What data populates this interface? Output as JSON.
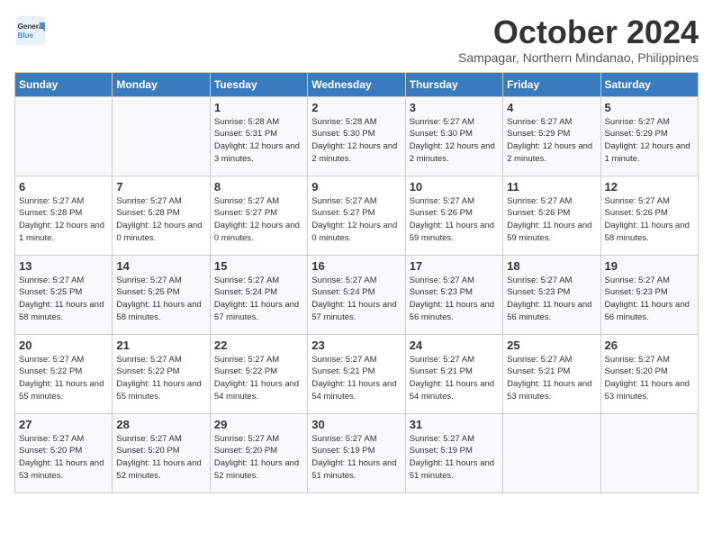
{
  "logo": {
    "line1": "General",
    "line2": "Blue"
  },
  "title": "October 2024",
  "subtitle": "Sampagar, Northern Mindanao, Philippines",
  "days_of_week": [
    "Sunday",
    "Monday",
    "Tuesday",
    "Wednesday",
    "Thursday",
    "Friday",
    "Saturday"
  ],
  "weeks": [
    [
      {
        "day": "",
        "info": ""
      },
      {
        "day": "",
        "info": ""
      },
      {
        "day": "1",
        "info": "Sunrise: 5:28 AM\nSunset: 5:31 PM\nDaylight: 12 hours and 3 minutes."
      },
      {
        "day": "2",
        "info": "Sunrise: 5:28 AM\nSunset: 5:30 PM\nDaylight: 12 hours and 2 minutes."
      },
      {
        "day": "3",
        "info": "Sunrise: 5:27 AM\nSunset: 5:30 PM\nDaylight: 12 hours and 2 minutes."
      },
      {
        "day": "4",
        "info": "Sunrise: 5:27 AM\nSunset: 5:29 PM\nDaylight: 12 hours and 2 minutes."
      },
      {
        "day": "5",
        "info": "Sunrise: 5:27 AM\nSunset: 5:29 PM\nDaylight: 12 hours and 1 minute."
      }
    ],
    [
      {
        "day": "6",
        "info": "Sunrise: 5:27 AM\nSunset: 5:28 PM\nDaylight: 12 hours and 1 minute."
      },
      {
        "day": "7",
        "info": "Sunrise: 5:27 AM\nSunset: 5:28 PM\nDaylight: 12 hours and 0 minutes."
      },
      {
        "day": "8",
        "info": "Sunrise: 5:27 AM\nSunset: 5:27 PM\nDaylight: 12 hours and 0 minutes."
      },
      {
        "day": "9",
        "info": "Sunrise: 5:27 AM\nSunset: 5:27 PM\nDaylight: 12 hours and 0 minutes."
      },
      {
        "day": "10",
        "info": "Sunrise: 5:27 AM\nSunset: 5:26 PM\nDaylight: 11 hours and 59 minutes."
      },
      {
        "day": "11",
        "info": "Sunrise: 5:27 AM\nSunset: 5:26 PM\nDaylight: 11 hours and 59 minutes."
      },
      {
        "day": "12",
        "info": "Sunrise: 5:27 AM\nSunset: 5:26 PM\nDaylight: 11 hours and 58 minutes."
      }
    ],
    [
      {
        "day": "13",
        "info": "Sunrise: 5:27 AM\nSunset: 5:25 PM\nDaylight: 11 hours and 58 minutes."
      },
      {
        "day": "14",
        "info": "Sunrise: 5:27 AM\nSunset: 5:25 PM\nDaylight: 11 hours and 58 minutes."
      },
      {
        "day": "15",
        "info": "Sunrise: 5:27 AM\nSunset: 5:24 PM\nDaylight: 11 hours and 57 minutes."
      },
      {
        "day": "16",
        "info": "Sunrise: 5:27 AM\nSunset: 5:24 PM\nDaylight: 11 hours and 57 minutes."
      },
      {
        "day": "17",
        "info": "Sunrise: 5:27 AM\nSunset: 5:23 PM\nDaylight: 11 hours and 56 minutes."
      },
      {
        "day": "18",
        "info": "Sunrise: 5:27 AM\nSunset: 5:23 PM\nDaylight: 11 hours and 56 minutes."
      },
      {
        "day": "19",
        "info": "Sunrise: 5:27 AM\nSunset: 5:23 PM\nDaylight: 11 hours and 56 minutes."
      }
    ],
    [
      {
        "day": "20",
        "info": "Sunrise: 5:27 AM\nSunset: 5:22 PM\nDaylight: 11 hours and 55 minutes."
      },
      {
        "day": "21",
        "info": "Sunrise: 5:27 AM\nSunset: 5:22 PM\nDaylight: 11 hours and 55 minutes."
      },
      {
        "day": "22",
        "info": "Sunrise: 5:27 AM\nSunset: 5:22 PM\nDaylight: 11 hours and 54 minutes."
      },
      {
        "day": "23",
        "info": "Sunrise: 5:27 AM\nSunset: 5:21 PM\nDaylight: 11 hours and 54 minutes."
      },
      {
        "day": "24",
        "info": "Sunrise: 5:27 AM\nSunset: 5:21 PM\nDaylight: 11 hours and 54 minutes."
      },
      {
        "day": "25",
        "info": "Sunrise: 5:27 AM\nSunset: 5:21 PM\nDaylight: 11 hours and 53 minutes."
      },
      {
        "day": "26",
        "info": "Sunrise: 5:27 AM\nSunset: 5:20 PM\nDaylight: 11 hours and 53 minutes."
      }
    ],
    [
      {
        "day": "27",
        "info": "Sunrise: 5:27 AM\nSunset: 5:20 PM\nDaylight: 11 hours and 53 minutes."
      },
      {
        "day": "28",
        "info": "Sunrise: 5:27 AM\nSunset: 5:20 PM\nDaylight: 11 hours and 52 minutes."
      },
      {
        "day": "29",
        "info": "Sunrise: 5:27 AM\nSunset: 5:20 PM\nDaylight: 11 hours and 52 minutes."
      },
      {
        "day": "30",
        "info": "Sunrise: 5:27 AM\nSunset: 5:19 PM\nDaylight: 11 hours and 51 minutes."
      },
      {
        "day": "31",
        "info": "Sunrise: 5:27 AM\nSunset: 5:19 PM\nDaylight: 11 hours and 51 minutes."
      },
      {
        "day": "",
        "info": ""
      },
      {
        "day": "",
        "info": ""
      }
    ]
  ]
}
